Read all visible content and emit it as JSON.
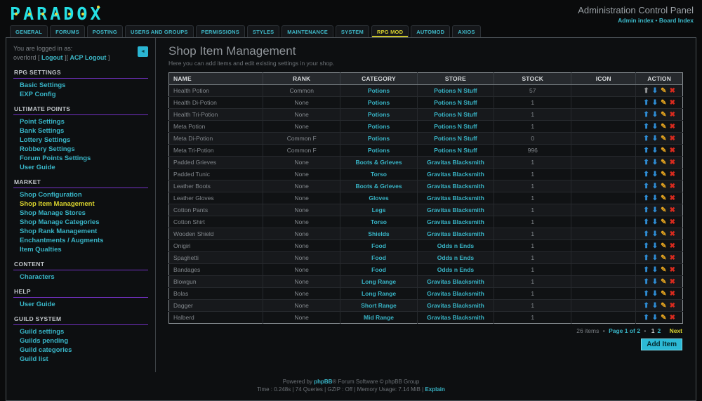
{
  "colors": {
    "accent_cyan": "#38b4c6",
    "logo_cyan": "#25dfe4",
    "logo_dot_yellow": "#ecd73a",
    "accent_yellow": "#d8d22e",
    "section_purple": "#7331c4",
    "action_arrow_blue": "#2f8fd8",
    "action_arrow_disabled": "#97999b",
    "action_edit_orange": "#e8a61f",
    "action_delete_red": "#d62a1e",
    "add_button_bg": "#2cb9d6"
  },
  "icons": {
    "move_up": "⬆",
    "move_down": "⬇",
    "edit": "✎",
    "delete": "✖",
    "collapse": "◄",
    "separator": "•"
  },
  "header": {
    "logo": "PARADOX",
    "title": "Administration Control Panel",
    "admin_index_label": "Admin index",
    "link_separator": "•",
    "board_index_label": "Board Index"
  },
  "tabs": [
    {
      "label": "GENERAL",
      "active": false
    },
    {
      "label": "FORUMS",
      "active": false
    },
    {
      "label": "POSTING",
      "active": false
    },
    {
      "label": "USERS AND GROUPS",
      "active": false
    },
    {
      "label": "PERMISSIONS",
      "active": false
    },
    {
      "label": "STYLES",
      "active": false
    },
    {
      "label": "MAINTENANCE",
      "active": false
    },
    {
      "label": "SYSTEM",
      "active": false
    },
    {
      "label": "RPG MOD",
      "active": true
    },
    {
      "label": "AUTOMOD",
      "active": false
    },
    {
      "label": "AXIOS",
      "active": false
    }
  ],
  "sidebar": {
    "logged_in_label": "You are logged in as:",
    "username": "overlord",
    "bracket_open": " [ ",
    "logout_label": "Logout",
    "bracket_mid": " ][ ",
    "acp_logout_label": "ACP Logout",
    "bracket_close": " ]",
    "sections": [
      {
        "title": "RPG SETTINGS",
        "items": [
          {
            "label": "Basic Settings",
            "active": false
          },
          {
            "label": "EXP Config",
            "active": false
          }
        ]
      },
      {
        "title": "ULTIMATE POINTS",
        "items": [
          {
            "label": "Point Settings",
            "active": false
          },
          {
            "label": "Bank Settings",
            "active": false
          },
          {
            "label": "Lottery Settings",
            "active": false
          },
          {
            "label": "Robbery Settings",
            "active": false
          },
          {
            "label": "Forum Points Settings",
            "active": false
          },
          {
            "label": "User Guide",
            "active": false
          }
        ]
      },
      {
        "title": "MARKET",
        "items": [
          {
            "label": "Shop Configuration",
            "active": false
          },
          {
            "label": "Shop Item Management",
            "active": true
          },
          {
            "label": "Shop Manage Stores",
            "active": false
          },
          {
            "label": "Shop Manage Categories",
            "active": false
          },
          {
            "label": "Shop Rank Management",
            "active": false
          },
          {
            "label": "Enchantments / Augments",
            "active": false
          },
          {
            "label": "Item Qualties",
            "active": false
          }
        ]
      },
      {
        "title": "CONTENT",
        "items": [
          {
            "label": "Characters",
            "active": false
          }
        ]
      },
      {
        "title": "HELP",
        "items": [
          {
            "label": "User Guide",
            "active": false
          }
        ]
      },
      {
        "title": "GUILD SYSTEM",
        "items": [
          {
            "label": "Guild settings",
            "active": false
          },
          {
            "label": "Guilds pending",
            "active": false
          },
          {
            "label": "Guild categories",
            "active": false
          },
          {
            "label": "Guild list",
            "active": false
          }
        ]
      }
    ]
  },
  "main": {
    "title": "Shop Item Management",
    "subtitle": "Here you can add items and edit existing settings in your shop.",
    "table": {
      "columns": [
        "NAME",
        "RANK",
        "CATEGORY",
        "STORE",
        "STOCK",
        "ICON",
        "ACTION"
      ],
      "rows": [
        {
          "name": "Health Potion",
          "rank": "Common",
          "category": "Potions",
          "store": "Potions N Stuff",
          "stock": "57",
          "up_disabled": true
        },
        {
          "name": "Health Di-Potion",
          "rank": "None",
          "category": "Potions",
          "store": "Potions N Stuff",
          "stock": "1"
        },
        {
          "name": "Health Tri-Potion",
          "rank": "None",
          "category": "Potions",
          "store": "Potions N Stuff",
          "stock": "1"
        },
        {
          "name": "Meta Potion",
          "rank": "None",
          "category": "Potions",
          "store": "Potions N Stuff",
          "stock": "1"
        },
        {
          "name": "Meta Di-Potion",
          "rank": "Common F",
          "category": "Potions",
          "store": "Potions N Stuff",
          "stock": "0"
        },
        {
          "name": "Meta Tri-Potion",
          "rank": "Common F",
          "category": "Potions",
          "store": "Potions N Stuff",
          "stock": "996"
        },
        {
          "name": "Padded Grieves",
          "rank": "None",
          "category": "Boots & Grieves",
          "store": "Gravitas Blacksmith",
          "stock": "1"
        },
        {
          "name": "Padded Tunic",
          "rank": "None",
          "category": "Torso",
          "store": "Gravitas Blacksmith",
          "stock": "1"
        },
        {
          "name": "Leather Boots",
          "rank": "None",
          "category": "Boots & Grieves",
          "store": "Gravitas Blacksmith",
          "stock": "1"
        },
        {
          "name": "Leather Gloves",
          "rank": "None",
          "category": "Gloves",
          "store": "Gravitas Blacksmith",
          "stock": "1"
        },
        {
          "name": "Cotton Pants",
          "rank": "None",
          "category": "Legs",
          "store": "Gravitas Blacksmith",
          "stock": "1"
        },
        {
          "name": "Cotton Shirt",
          "rank": "None",
          "category": "Torso",
          "store": "Gravitas Blacksmith",
          "stock": "1"
        },
        {
          "name": "Wooden Shield",
          "rank": "None",
          "category": "Shields",
          "store": "Gravitas Blacksmith",
          "stock": "1"
        },
        {
          "name": "Onigiri",
          "rank": "None",
          "category": "Food",
          "store": "Odds n Ends",
          "stock": "1"
        },
        {
          "name": "Spaghetti",
          "rank": "None",
          "category": "Food",
          "store": "Odds n Ends",
          "stock": "1"
        },
        {
          "name": "Bandages",
          "rank": "None",
          "category": "Food",
          "store": "Odds n Ends",
          "stock": "1"
        },
        {
          "name": "Blowgun",
          "rank": "None",
          "category": "Long Range",
          "store": "Gravitas Blacksmith",
          "stock": "1"
        },
        {
          "name": "Bolas",
          "rank": "None",
          "category": "Long Range",
          "store": "Gravitas Blacksmith",
          "stock": "1"
        },
        {
          "name": "Dagger",
          "rank": "None",
          "category": "Short Range",
          "store": "Gravitas Blacksmith",
          "stock": "1"
        },
        {
          "name": "Halberd",
          "rank": "None",
          "category": "Mid Range",
          "store": "Gravitas Blacksmith",
          "stock": "1"
        }
      ]
    },
    "pagination": {
      "items_text": "26 items",
      "separator": "•",
      "page_text": "Page 1 of 2",
      "pages": [
        {
          "label": "1",
          "current": true
        },
        {
          "label": "2",
          "current": false
        }
      ],
      "next_label": "Next"
    },
    "add_item_label": "Add Item"
  },
  "footer": {
    "powered_prefix": "Powered by ",
    "phpbb_label": "phpBB",
    "powered_suffix": "® Forum Software © phpBB Group",
    "stats_text": "Time : 0.248s | 74 Queries | GZIP : Off | Memory Usage: 7.14 MiB | ",
    "explain_label": "Explain"
  }
}
